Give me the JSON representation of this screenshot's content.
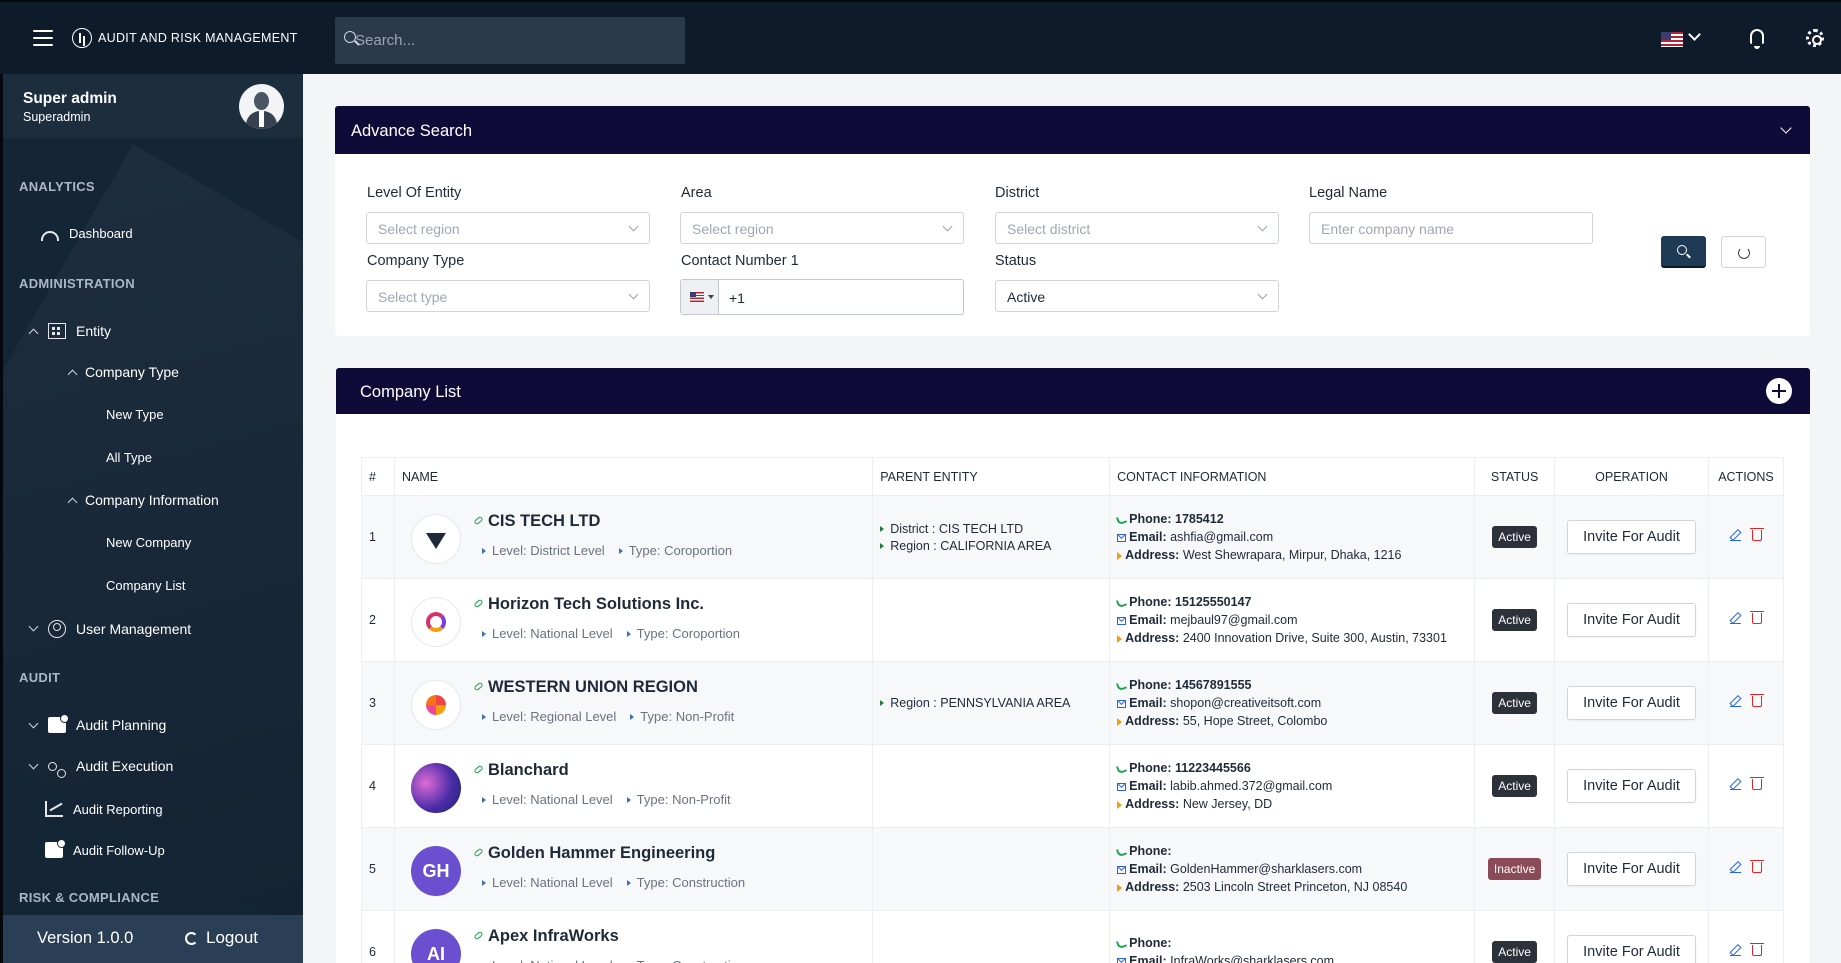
{
  "app": {
    "title": "AUDIT AND RISK MANAGEMENT",
    "search_placeholder": "Search..."
  },
  "user": {
    "name": "Super admin",
    "role": "Superadmin"
  },
  "sidebar": {
    "sections": {
      "analytics": "ANALYTICS",
      "administration": "ADMINISTRATION",
      "audit": "AUDIT",
      "risk": "RISK & COMPLIANCE"
    },
    "items": {
      "dashboard": "Dashboard",
      "entity": "Entity",
      "company_type": "Company Type",
      "new_type": "New Type",
      "all_type": "All Type",
      "company_information": "Company Information",
      "new_company": "New Company",
      "company_list": "Company List",
      "user_management": "User Management",
      "audit_planning": "Audit Planning",
      "audit_execution": "Audit Execution",
      "audit_reporting": "Audit Reporting",
      "audit_follow_up": "Audit Follow-Up"
    },
    "version": "Version 1.0.0",
    "logout": "Logout"
  },
  "advance_search": {
    "title": "Advance Search",
    "fields": {
      "level_label": "Level Of Entity",
      "level_placeholder": "Select region",
      "area_label": "Area",
      "area_placeholder": "Select region",
      "district_label": "District",
      "district_placeholder": "Select district",
      "legal_label": "Legal Name",
      "legal_placeholder": "Enter company name",
      "type_label": "Company Type",
      "type_placeholder": "Select type",
      "contact_label": "Contact Number 1",
      "contact_value": "+1",
      "status_label": "Status",
      "status_value": "Active"
    }
  },
  "company_list": {
    "title": "Company List",
    "columns": [
      "#",
      "NAME",
      "PARENT ENTITY",
      "CONTACT INFORMATION",
      "STATUS",
      "OPERATION",
      "ACTIONS"
    ],
    "level_prefix": "Level: ",
    "type_prefix": "Type: ",
    "phone_label": "Phone:",
    "email_label": "Email:",
    "address_label": "Address:",
    "invite_label": "Invite For Audit",
    "rows": [
      {
        "num": "1",
        "name": "CIS TECH LTD",
        "level": "District Level",
        "type": "Coroportion",
        "parent": [
          "District : CIS TECH LTD",
          "Region : CALIFORNIA AREA"
        ],
        "phone": "1785412",
        "email": "ashfia@gmail.com",
        "address": "West Shewrapara, Mirpur, Dhaka, 1216",
        "status": "Active",
        "logo": "tech"
      },
      {
        "num": "2",
        "name": "Horizon Tech Solutions Inc.",
        "level": "National Level",
        "type": "Coroportion",
        "parent": [],
        "phone": "15125550147",
        "email": "mejbaul97@gmail.com",
        "address": "2400 Innovation Drive, Suite 300, Austin, 73301",
        "status": "Active",
        "logo": "horizon"
      },
      {
        "num": "3",
        "name": "WESTERN UNION REGION",
        "level": "Regional Level",
        "type": "Non-Profit",
        "parent": [
          "Region : PENNSYLVANIA AREA"
        ],
        "phone": "14567891555",
        "email": "shopon@creativeitsoft.com",
        "address": "55, Hope Street, Colombo",
        "status": "Active",
        "logo": "union"
      },
      {
        "num": "4",
        "name": "Blanchard",
        "level": "National Level",
        "type": "Non-Profit",
        "parent": [],
        "phone": "11223445566",
        "email": "labib.ahmed.372@gmail.com",
        "address": "New Jersey, DD",
        "status": "Active",
        "logo": "photo"
      },
      {
        "num": "5",
        "name": "Golden Hammer Engineering",
        "level": "National Level",
        "type": "Construction",
        "parent": [],
        "phone": "",
        "email": "GoldenHammer@sharklasers.com",
        "address": "2503 Lincoln Street Princeton, NJ 08540",
        "status": "Inactive",
        "logo": "GH"
      },
      {
        "num": "6",
        "name": "Apex InfraWorks",
        "level": "National Level",
        "type": "Construction",
        "parent": [],
        "phone": "",
        "email": "InfraWorks@sharklasers.com",
        "address": "",
        "status": "Active",
        "logo": "AI"
      }
    ]
  }
}
